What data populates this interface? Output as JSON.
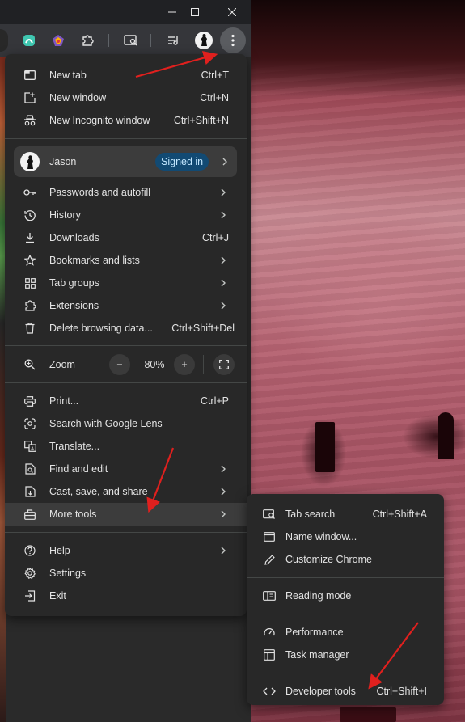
{
  "window_controls": {
    "minimize_icon": "minimize-icon",
    "maximize_icon": "maximize-icon",
    "close_icon": "close-icon"
  },
  "toolbar": {
    "icons": [
      "extension-app-icon",
      "colorful-extension-icon",
      "puzzle-icon",
      "tab-search-icon",
      "reading-list-icon",
      "profile-avatar",
      "more-menu-icon"
    ]
  },
  "main_menu": {
    "new_tab": {
      "label": "New tab",
      "shortcut": "Ctrl+T"
    },
    "new_window": {
      "label": "New window",
      "shortcut": "Ctrl+N"
    },
    "new_incognito": {
      "label": "New Incognito window",
      "shortcut": "Ctrl+Shift+N"
    },
    "profile": {
      "name": "Jason",
      "status": "Signed in"
    },
    "passwords": {
      "label": "Passwords and autofill"
    },
    "history": {
      "label": "History"
    },
    "downloads": {
      "label": "Downloads",
      "shortcut": "Ctrl+J"
    },
    "bookmarks": {
      "label": "Bookmarks and lists"
    },
    "tab_groups": {
      "label": "Tab groups"
    },
    "extensions": {
      "label": "Extensions"
    },
    "delete_data": {
      "label": "Delete browsing data...",
      "shortcut": "Ctrl+Shift+Del"
    },
    "zoom": {
      "label": "Zoom",
      "minus": "−",
      "value": "80%",
      "plus": "+"
    },
    "print": {
      "label": "Print...",
      "shortcut": "Ctrl+P"
    },
    "lens": {
      "label": "Search with Google Lens"
    },
    "translate": {
      "label": "Translate..."
    },
    "find_edit": {
      "label": "Find and edit"
    },
    "cast": {
      "label": "Cast, save, and share"
    },
    "more_tools": {
      "label": "More tools"
    },
    "help": {
      "label": "Help"
    },
    "settings": {
      "label": "Settings"
    },
    "exit": {
      "label": "Exit"
    }
  },
  "sub_menu": {
    "tab_search": {
      "label": "Tab search",
      "shortcut": "Ctrl+Shift+A"
    },
    "name_window": {
      "label": "Name window..."
    },
    "customize": {
      "label": "Customize Chrome"
    },
    "reading_mode": {
      "label": "Reading mode"
    },
    "performance": {
      "label": "Performance"
    },
    "task_manager": {
      "label": "Task manager"
    },
    "dev_tools": {
      "label": "Developer tools",
      "shortcut": "Ctrl+Shift+I"
    }
  },
  "colors": {
    "menu_bg": "#282828",
    "highlight": "#3c3c3c",
    "signed_in_bg": "#124a73",
    "signed_in_text": "#c2e7ff",
    "annotation_arrow": "#e0201e"
  }
}
